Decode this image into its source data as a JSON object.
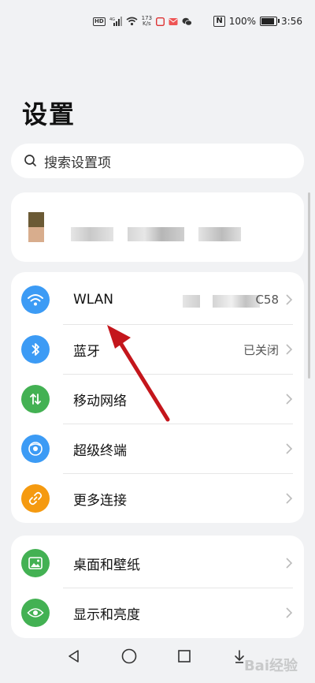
{
  "status_bar": {
    "hd_label": "HD",
    "network_label": "4G",
    "speed_value": "173",
    "speed_unit": "K/s",
    "nfc_label": "N",
    "battery_percent": "100%",
    "battery_level": 1.0,
    "time": "3:56"
  },
  "page": {
    "title": "设置"
  },
  "search": {
    "placeholder": "搜索设置项",
    "icon": "search-icon"
  },
  "account": {
    "avatar": "avatar",
    "name_redacted": true
  },
  "connection_items": [
    {
      "label": "WLAN",
      "value": "C58",
      "icon": "wifi-icon",
      "color": "#3c9bf5"
    },
    {
      "label": "蓝牙",
      "value": "已关闭",
      "icon": "bluetooth-icon",
      "color": "#3c9bf5"
    },
    {
      "label": "移动网络",
      "value": "",
      "icon": "mobile-network-icon",
      "color": "#43b153"
    },
    {
      "label": "超级终端",
      "value": "",
      "icon": "super-device-icon",
      "color": "#3c9bf5"
    },
    {
      "label": "更多连接",
      "value": "",
      "icon": "link-icon",
      "color": "#f59a10"
    }
  ],
  "display_items": [
    {
      "label": "桌面和壁纸",
      "icon": "wallpaper-icon",
      "color": "#43b153"
    },
    {
      "label": "显示和亮度",
      "icon": "eye-icon",
      "color": "#43b153"
    }
  ],
  "nav": {
    "back": "back-icon",
    "home": "home-icon",
    "recents": "recents-icon",
    "down": "down-icon"
  },
  "watermark": {
    "text": "Bai经验"
  },
  "colors": {
    "accent_blue": "#3c9bf5",
    "accent_green": "#43b153",
    "accent_orange": "#f59a10",
    "annotation_red": "#c4161c"
  }
}
